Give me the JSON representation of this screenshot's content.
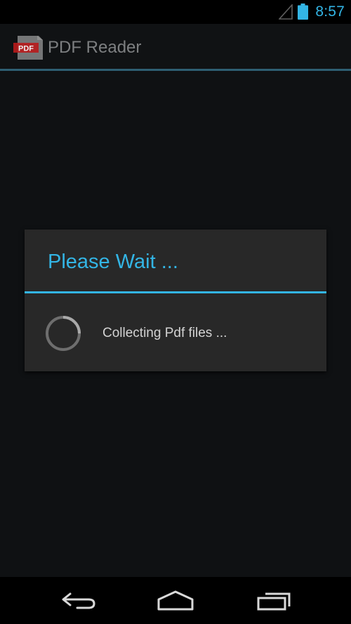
{
  "status_bar": {
    "time": "8:57",
    "icons": [
      "signal-icon",
      "battery-icon"
    ],
    "accent_color": "#33b5e5"
  },
  "action_bar": {
    "app_icon": "pdf-icon",
    "app_icon_text": "PDF",
    "title": "PDF Reader"
  },
  "dialog": {
    "title": "Please Wait ...",
    "message": "Collecting Pdf files ...",
    "spinner": "progress-spinner-icon"
  },
  "nav_bar": {
    "buttons": [
      "back-icon",
      "home-icon",
      "recents-icon"
    ]
  }
}
